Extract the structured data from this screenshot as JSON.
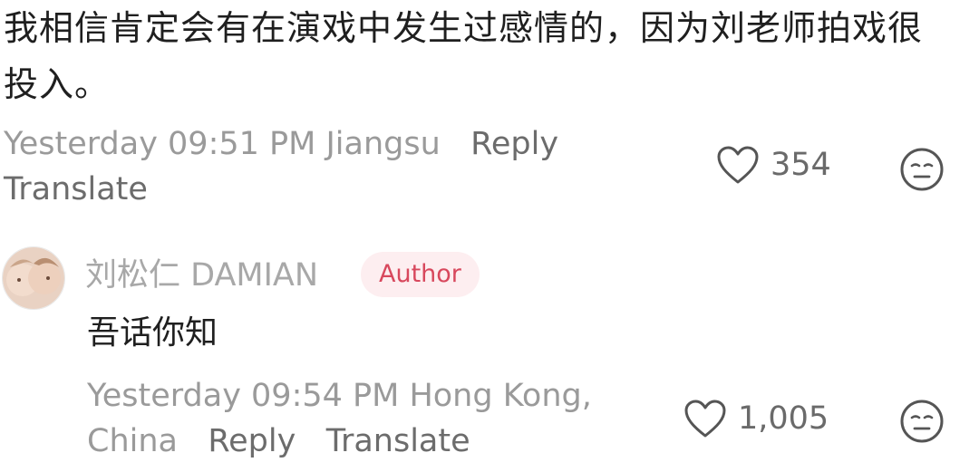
{
  "comment1": {
    "text": "我相信肯定会有在演戏中发生过感情的，因为刘老师拍戏很投入。",
    "timestamp_location": "Yesterday 09:51 PM Jiangsu",
    "reply_label": "Reply",
    "translate_label": "Translate",
    "likes": "354"
  },
  "comment2": {
    "author": "刘松仁 DAMIAN",
    "badge": "Author",
    "text": "吾话你知",
    "timestamp_location": "Yesterday 09:54 PM Hong Kong, China",
    "reply_label": "Reply",
    "translate_label": "Translate",
    "likes": "1,005"
  },
  "colors": {
    "badge_bg": "#fdeef0",
    "badge_text": "#d8485d",
    "meta_gray": "#9a9a9a"
  },
  "icons": [
    "heart-icon",
    "dislike-face-icon",
    "avatar"
  ]
}
